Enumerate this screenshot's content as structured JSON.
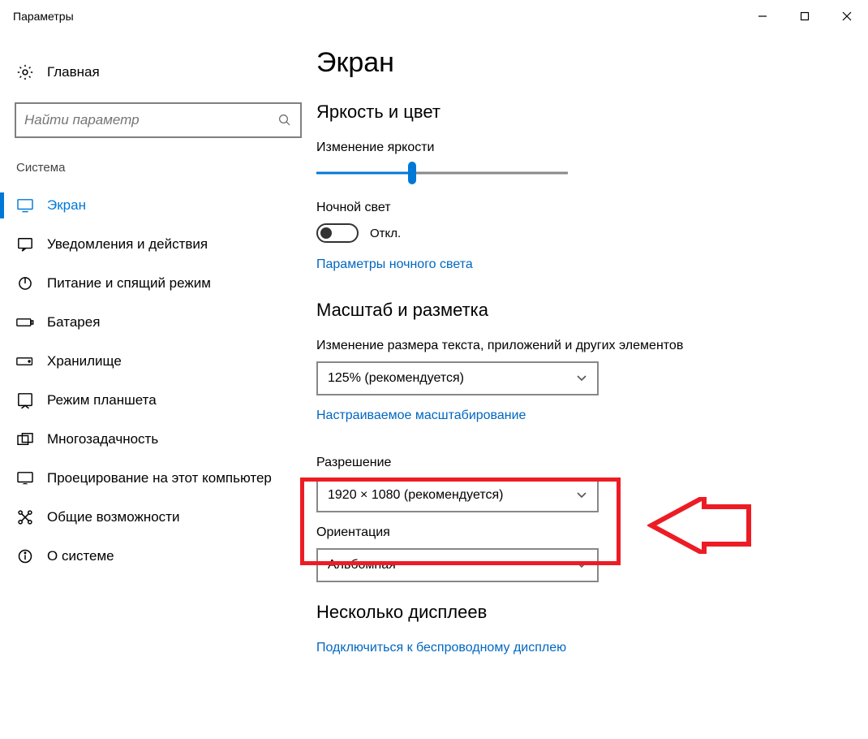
{
  "window": {
    "title": "Параметры"
  },
  "sidebar": {
    "home": "Главная",
    "search_placeholder": "Найти параметр",
    "category": "Система",
    "items": [
      {
        "label": "Экран",
        "icon": "display-icon",
        "active": true
      },
      {
        "label": "Уведомления и действия",
        "icon": "notifications-icon"
      },
      {
        "label": "Питание и спящий режим",
        "icon": "power-icon"
      },
      {
        "label": "Батарея",
        "icon": "battery-icon"
      },
      {
        "label": "Хранилище",
        "icon": "storage-icon"
      },
      {
        "label": "Режим планшета",
        "icon": "tablet-mode-icon"
      },
      {
        "label": "Многозадачность",
        "icon": "multitasking-icon"
      },
      {
        "label": "Проецирование на этот компьютер",
        "icon": "projecting-icon"
      },
      {
        "label": "Общие возможности",
        "icon": "shared-experiences-icon"
      },
      {
        "label": "О системе",
        "icon": "about-icon"
      }
    ]
  },
  "main": {
    "title": "Экран",
    "section_brightness": "Яркость и цвет",
    "brightness_label": "Изменение яркости",
    "nightlight_label": "Ночной свет",
    "nightlight_state": "Откл.",
    "nightlight_link": "Параметры ночного света",
    "section_scale": "Масштаб и разметка",
    "scale_label": "Изменение размера текста, приложений и других элементов",
    "scale_value": "125% (рекомендуется)",
    "scale_link": "Настраиваемое масштабирование",
    "resolution_label": "Разрешение",
    "resolution_value": "1920 × 1080 (рекомендуется)",
    "orientation_label": "Ориентация",
    "orientation_value": "Альбомная",
    "section_multi": "Несколько дисплеев",
    "wireless_link": "Подключиться к беспроводному дисплею"
  }
}
